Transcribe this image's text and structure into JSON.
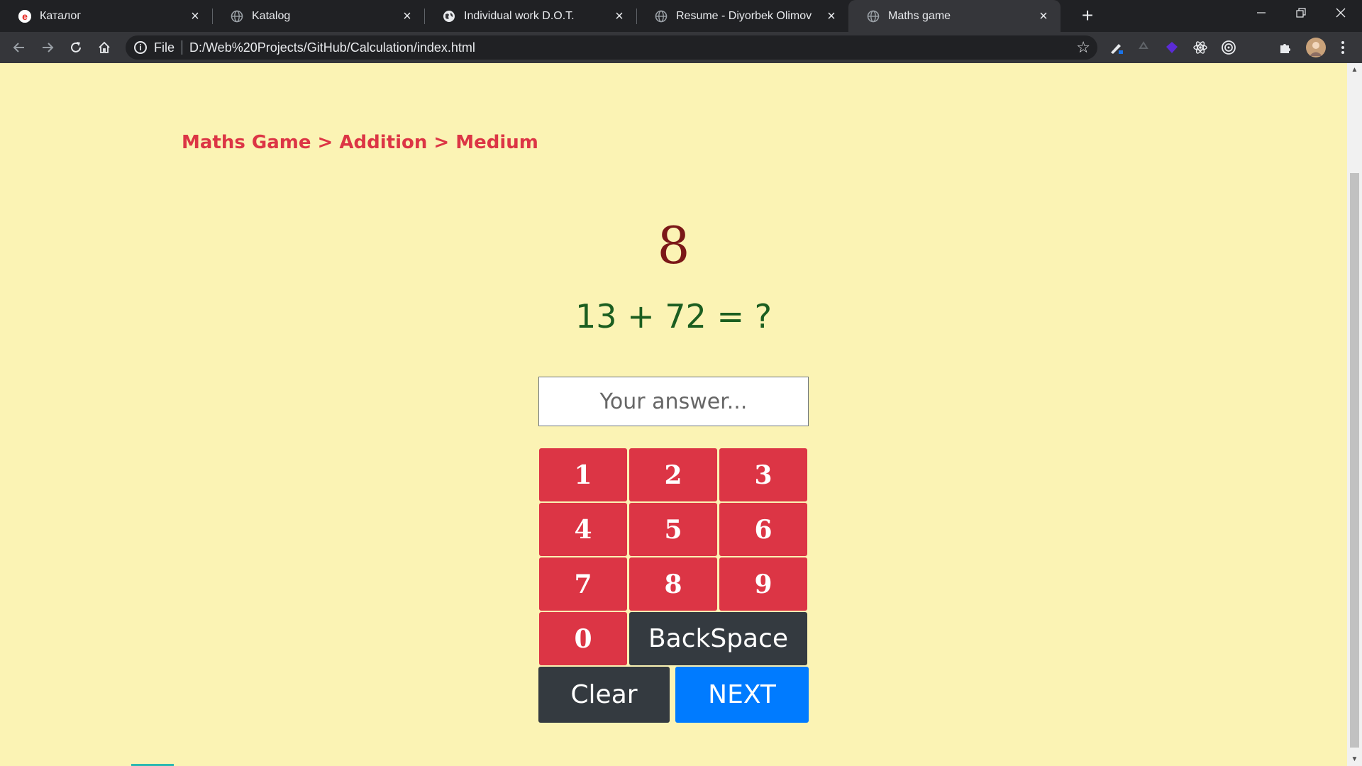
{
  "browser": {
    "tabs": [
      {
        "title": "Каталог",
        "favicon": "yandex-icon",
        "active": false
      },
      {
        "title": "Katalog",
        "favicon": "globe-icon",
        "active": false
      },
      {
        "title": "Individual work D.O.T.",
        "favicon": "globe-icon",
        "active": false
      },
      {
        "title": "Resume - Diyorbek Olimov",
        "favicon": "globe-icon",
        "active": false
      },
      {
        "title": "Maths game",
        "favicon": "globe-icon",
        "active": true
      }
    ],
    "address": {
      "scheme_label": "File",
      "url": "D:/Web%20Projects/GitHub/Calculation/index.html"
    },
    "colors": {
      "chrome_dark": "#202124",
      "chrome_toolbar": "#35363a"
    }
  },
  "game": {
    "breadcrumb": "Maths Game > Addition > Medium",
    "timer": "8",
    "question": "13 + 72 = ?",
    "answer_placeholder": "Your answer...",
    "keypad": {
      "digits": [
        "1",
        "2",
        "3",
        "4",
        "5",
        "6",
        "7",
        "8",
        "9",
        "0"
      ],
      "backspace": "BackSpace",
      "clear": "Clear",
      "next": "NEXT"
    },
    "colors": {
      "background": "#fbf3b4",
      "accent_red": "#dc3545",
      "timer": "#7b1818",
      "question": "#1b5e20",
      "dark_button": "#343a40",
      "primary_button": "#007bff"
    }
  }
}
